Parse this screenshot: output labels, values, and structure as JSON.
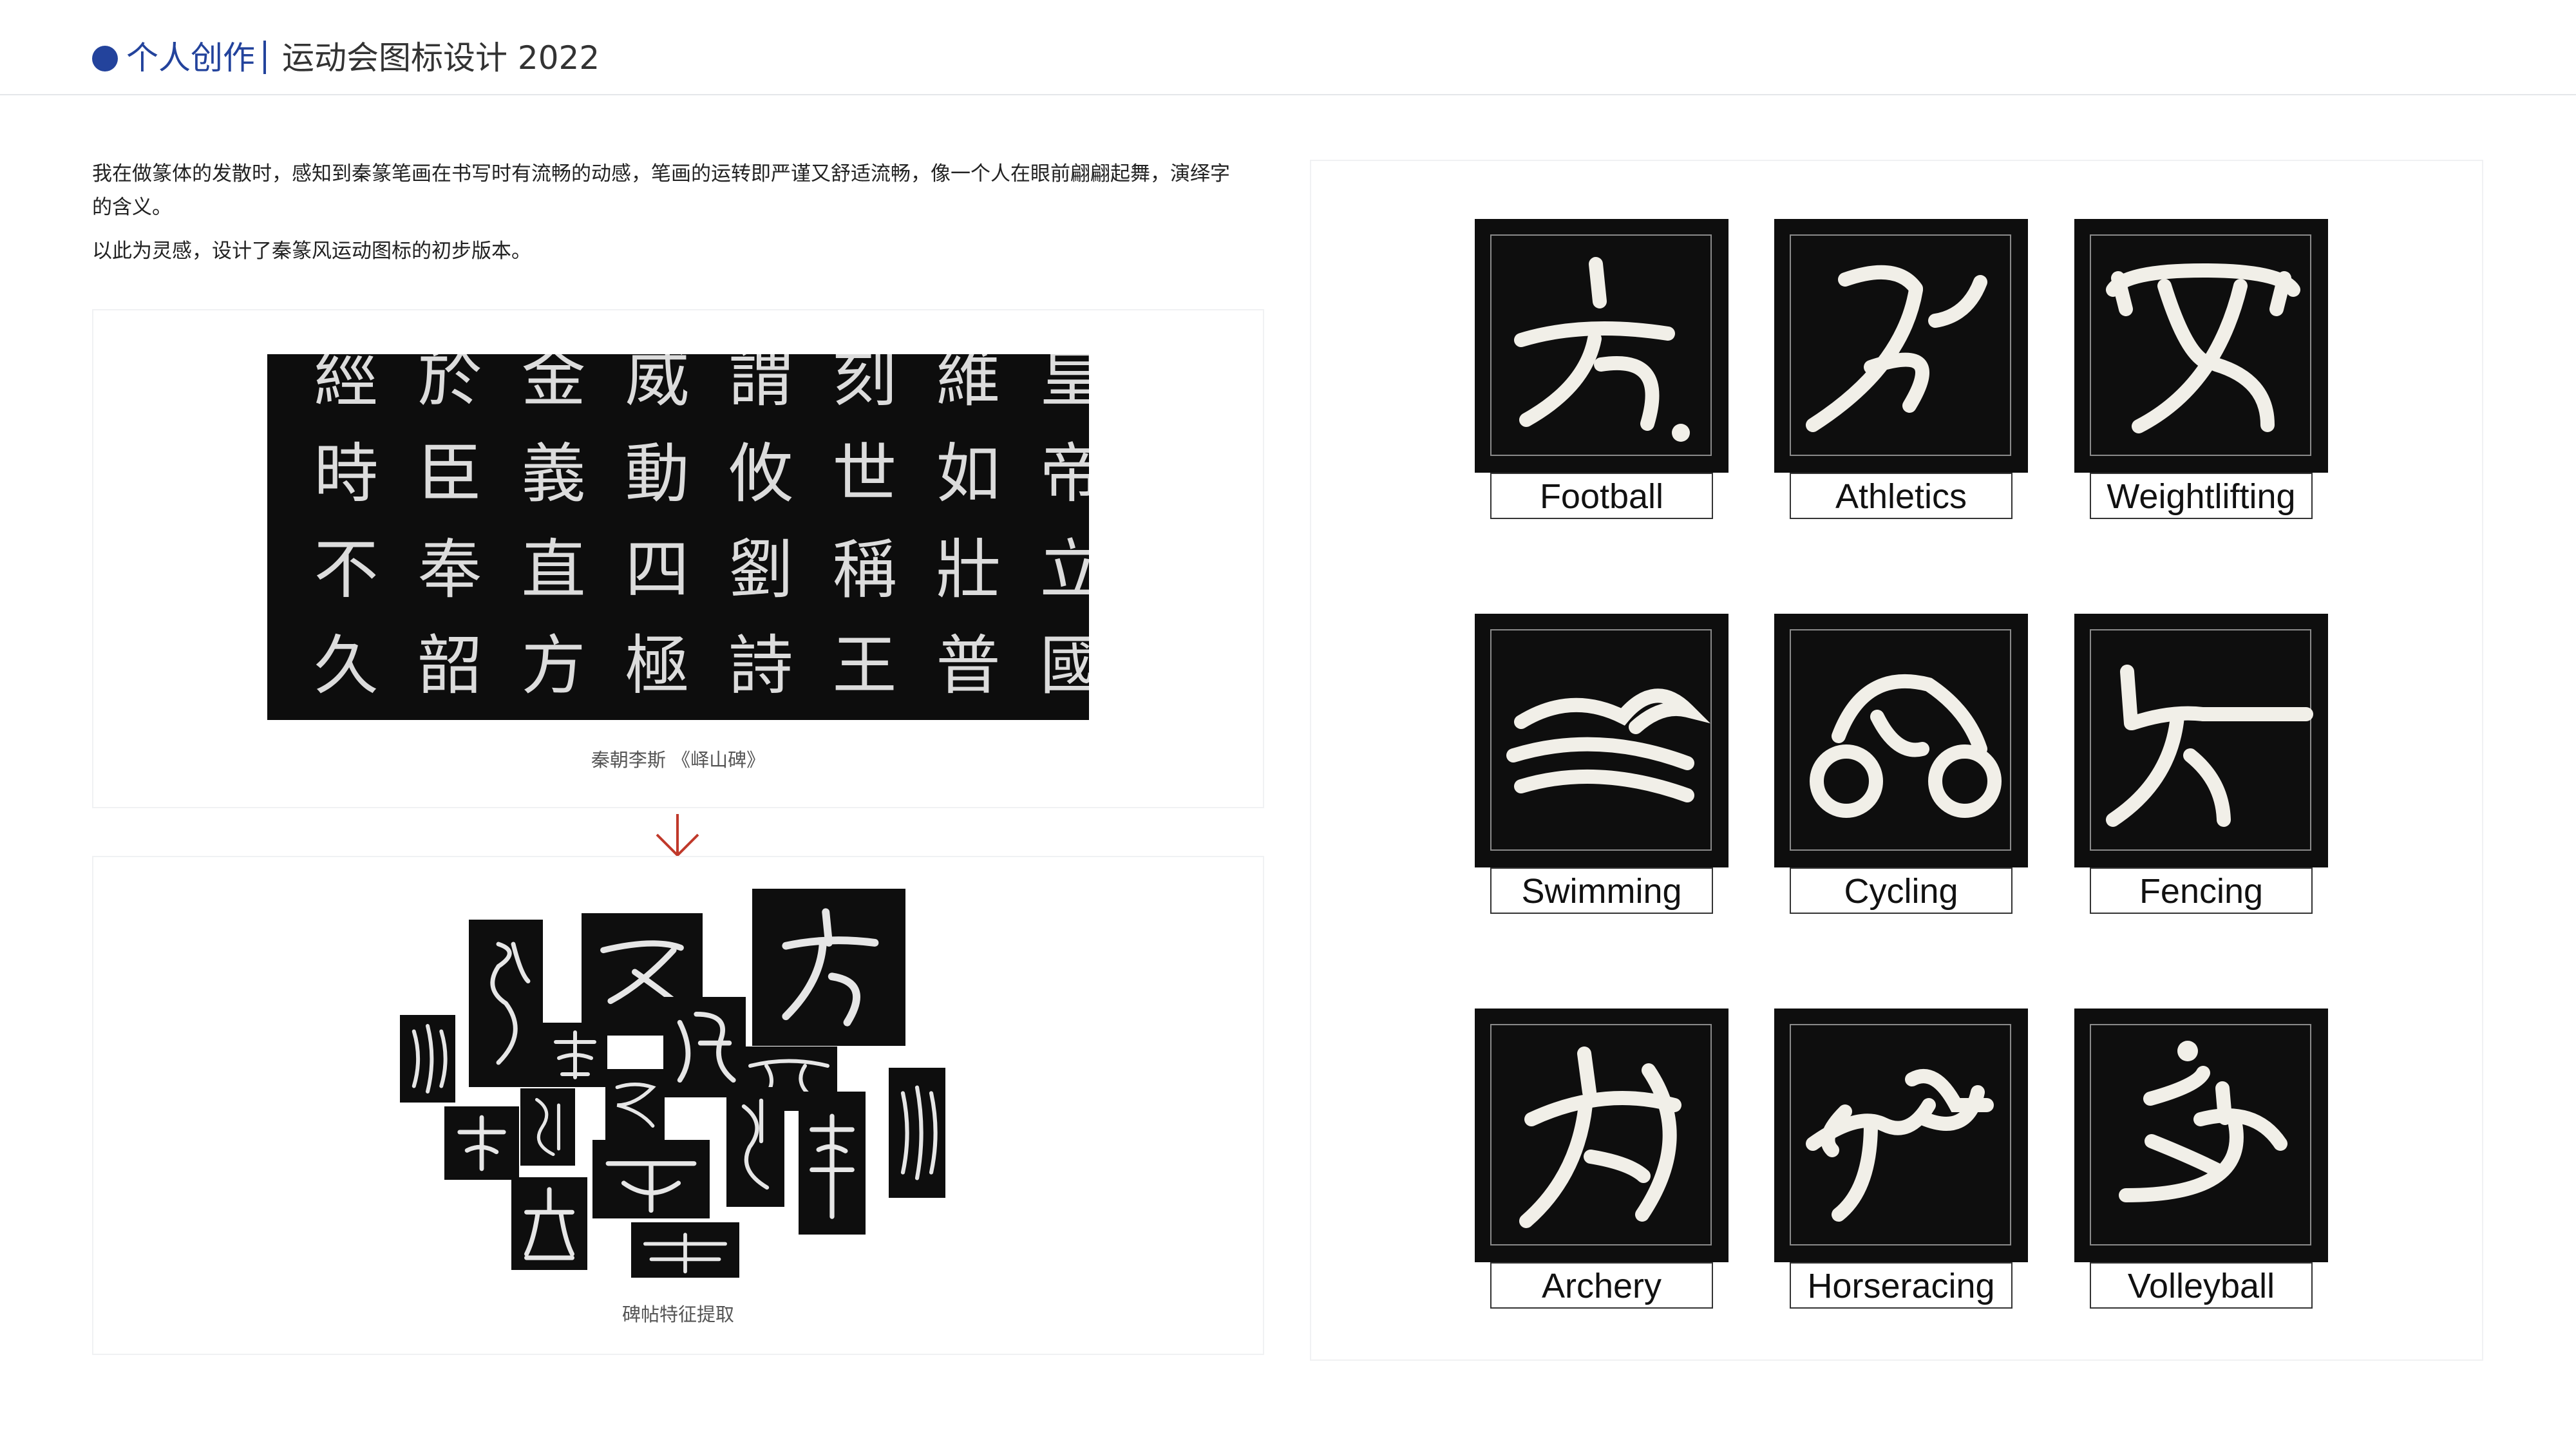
{
  "header": {
    "section": "个人创作",
    "title": "运动会图标设计 2022",
    "accent_color": "#23439c"
  },
  "description": {
    "line1": "我在做篆体的发散时，感知到秦篆笔画在书写时有流畅的动感，笔画的运转即严谨又舒适流畅，像一个人在眼前翩翩起舞，演绎字",
    "line2": "的含义。",
    "line3": "以此为灵感，设计了秦篆风运动图标的初步版本。"
  },
  "stele": {
    "caption": "秦朝李斯 《峄山碑》",
    "characters": [
      [
        "經",
        "於",
        "金",
        "威",
        "謂",
        "刻",
        "維",
        "皇"
      ],
      [
        "時",
        "臣",
        "義",
        "動",
        "攸",
        "世",
        "如",
        "帝"
      ],
      [
        "不",
        "奉",
        "直",
        "四",
        "劉",
        "稱",
        "壯",
        "立"
      ],
      [
        "久",
        "韶",
        "方",
        "極",
        "詩",
        "王",
        "普",
        "國"
      ]
    ]
  },
  "collage": {
    "caption": "碑帖特征提取"
  },
  "arrow": {
    "icon": "arrow-down-icon",
    "color": "#c0392b"
  },
  "icons": [
    {
      "label": "Football",
      "icon": "football-icon"
    },
    {
      "label": "Athletics",
      "icon": "athletics-icon"
    },
    {
      "label": "Weightlifting",
      "icon": "weightlifting-icon"
    },
    {
      "label": "Swimming",
      "icon": "swimming-icon"
    },
    {
      "label": "Cycling",
      "icon": "cycling-icon"
    },
    {
      "label": "Fencing",
      "icon": "fencing-icon"
    },
    {
      "label": "Archery",
      "icon": "archery-icon"
    },
    {
      "label": "Horseracing",
      "icon": "horseracing-icon"
    },
    {
      "label": "Volleyball",
      "icon": "volleyball-icon"
    }
  ]
}
